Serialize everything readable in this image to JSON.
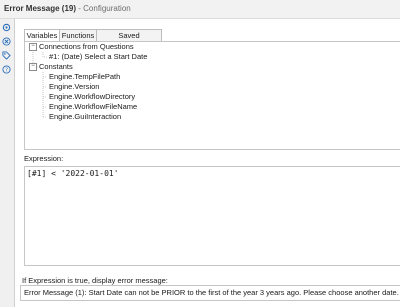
{
  "window": {
    "title_main": "Error Message (19)",
    "title_sep": " - ",
    "title_sub": "Configuration"
  },
  "side_rail": {
    "icons": [
      "settings-gear-icon",
      "close-circle-icon",
      "tag-icon",
      "help-icon"
    ]
  },
  "tabs": [
    {
      "label": "Variables",
      "active": true
    },
    {
      "label": "Functions",
      "active": false
    },
    {
      "label": "Saved Expressions",
      "active": false
    }
  ],
  "tree": {
    "groups": [
      {
        "label": "Connections from Questions",
        "expanded": true,
        "items": [
          "#1: (Date) Select a Start Date"
        ]
      },
      {
        "label": "Constants",
        "expanded": true,
        "items": [
          "Engine.TempFilePath",
          "Engine.Version",
          "Engine.WorkflowDirectory",
          "Engine.WorkflowFileName",
          "Engine.GuiInteraction"
        ]
      }
    ]
  },
  "expression": {
    "label": "Expression:",
    "value": "[#1] < '2022-01-01'"
  },
  "error_message": {
    "label": "If Expression is true, display error message:",
    "value": "Error Message (1): Start Date can not be PRIOR to the first of the year 3 years ago. Please choose another date."
  },
  "colors": {
    "accent": "#2a6ebb",
    "border": "#c6c6c6",
    "chrome": "#f2f2f2"
  }
}
